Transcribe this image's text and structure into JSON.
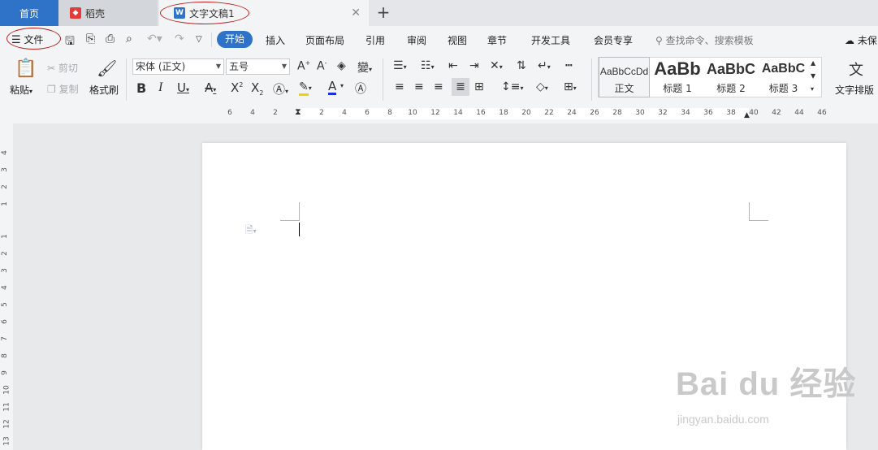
{
  "tabs": {
    "home": "首页",
    "docer": "稻壳",
    "document": "文字文稿1",
    "add": "+",
    "close": "✕"
  },
  "menu": {
    "file": "文件",
    "items": [
      "开始",
      "插入",
      "页面布局",
      "引用",
      "审阅",
      "视图",
      "章节",
      "开发工具",
      "会员专享"
    ],
    "search": "查找命令、搜索模板",
    "cloud": "未保"
  },
  "ribbon": {
    "paste": "粘贴",
    "cut": "剪切",
    "copy": "复制",
    "format_painter": "格式刷",
    "font_name": "宋体 (正文)",
    "font_size": "五号",
    "styles": [
      {
        "preview": "AaBbCcDd",
        "label": "正文"
      },
      {
        "preview": "AaBb",
        "label": "标题 1"
      },
      {
        "preview": "AaBbC",
        "label": "标题 2"
      },
      {
        "preview": "AaBbC",
        "label": "标题 3"
      }
    ],
    "text_layout": "文字排版"
  },
  "ruler": {
    "h_ticks": [
      "6",
      "4",
      "2",
      "2",
      "4",
      "6",
      "8",
      "10",
      "12",
      "14",
      "16",
      "18",
      "20",
      "22",
      "24",
      "26",
      "28",
      "30",
      "32",
      "34",
      "36",
      "38",
      "40",
      "42",
      "44",
      "46"
    ],
    "v_ticks": [
      "4",
      "3",
      "2",
      "1",
      "1",
      "2",
      "3",
      "4",
      "5",
      "6",
      "7",
      "8",
      "9",
      "10",
      "11",
      "12",
      "13"
    ]
  },
  "watermark": {
    "brand": "Bai du 经验",
    "url": "jingyan.baidu.com"
  },
  "colors": {
    "accent": "#2f73c9",
    "highlight": "#f2d100",
    "font_color": "#1a2ee6",
    "annotation": "#c21a1a"
  }
}
